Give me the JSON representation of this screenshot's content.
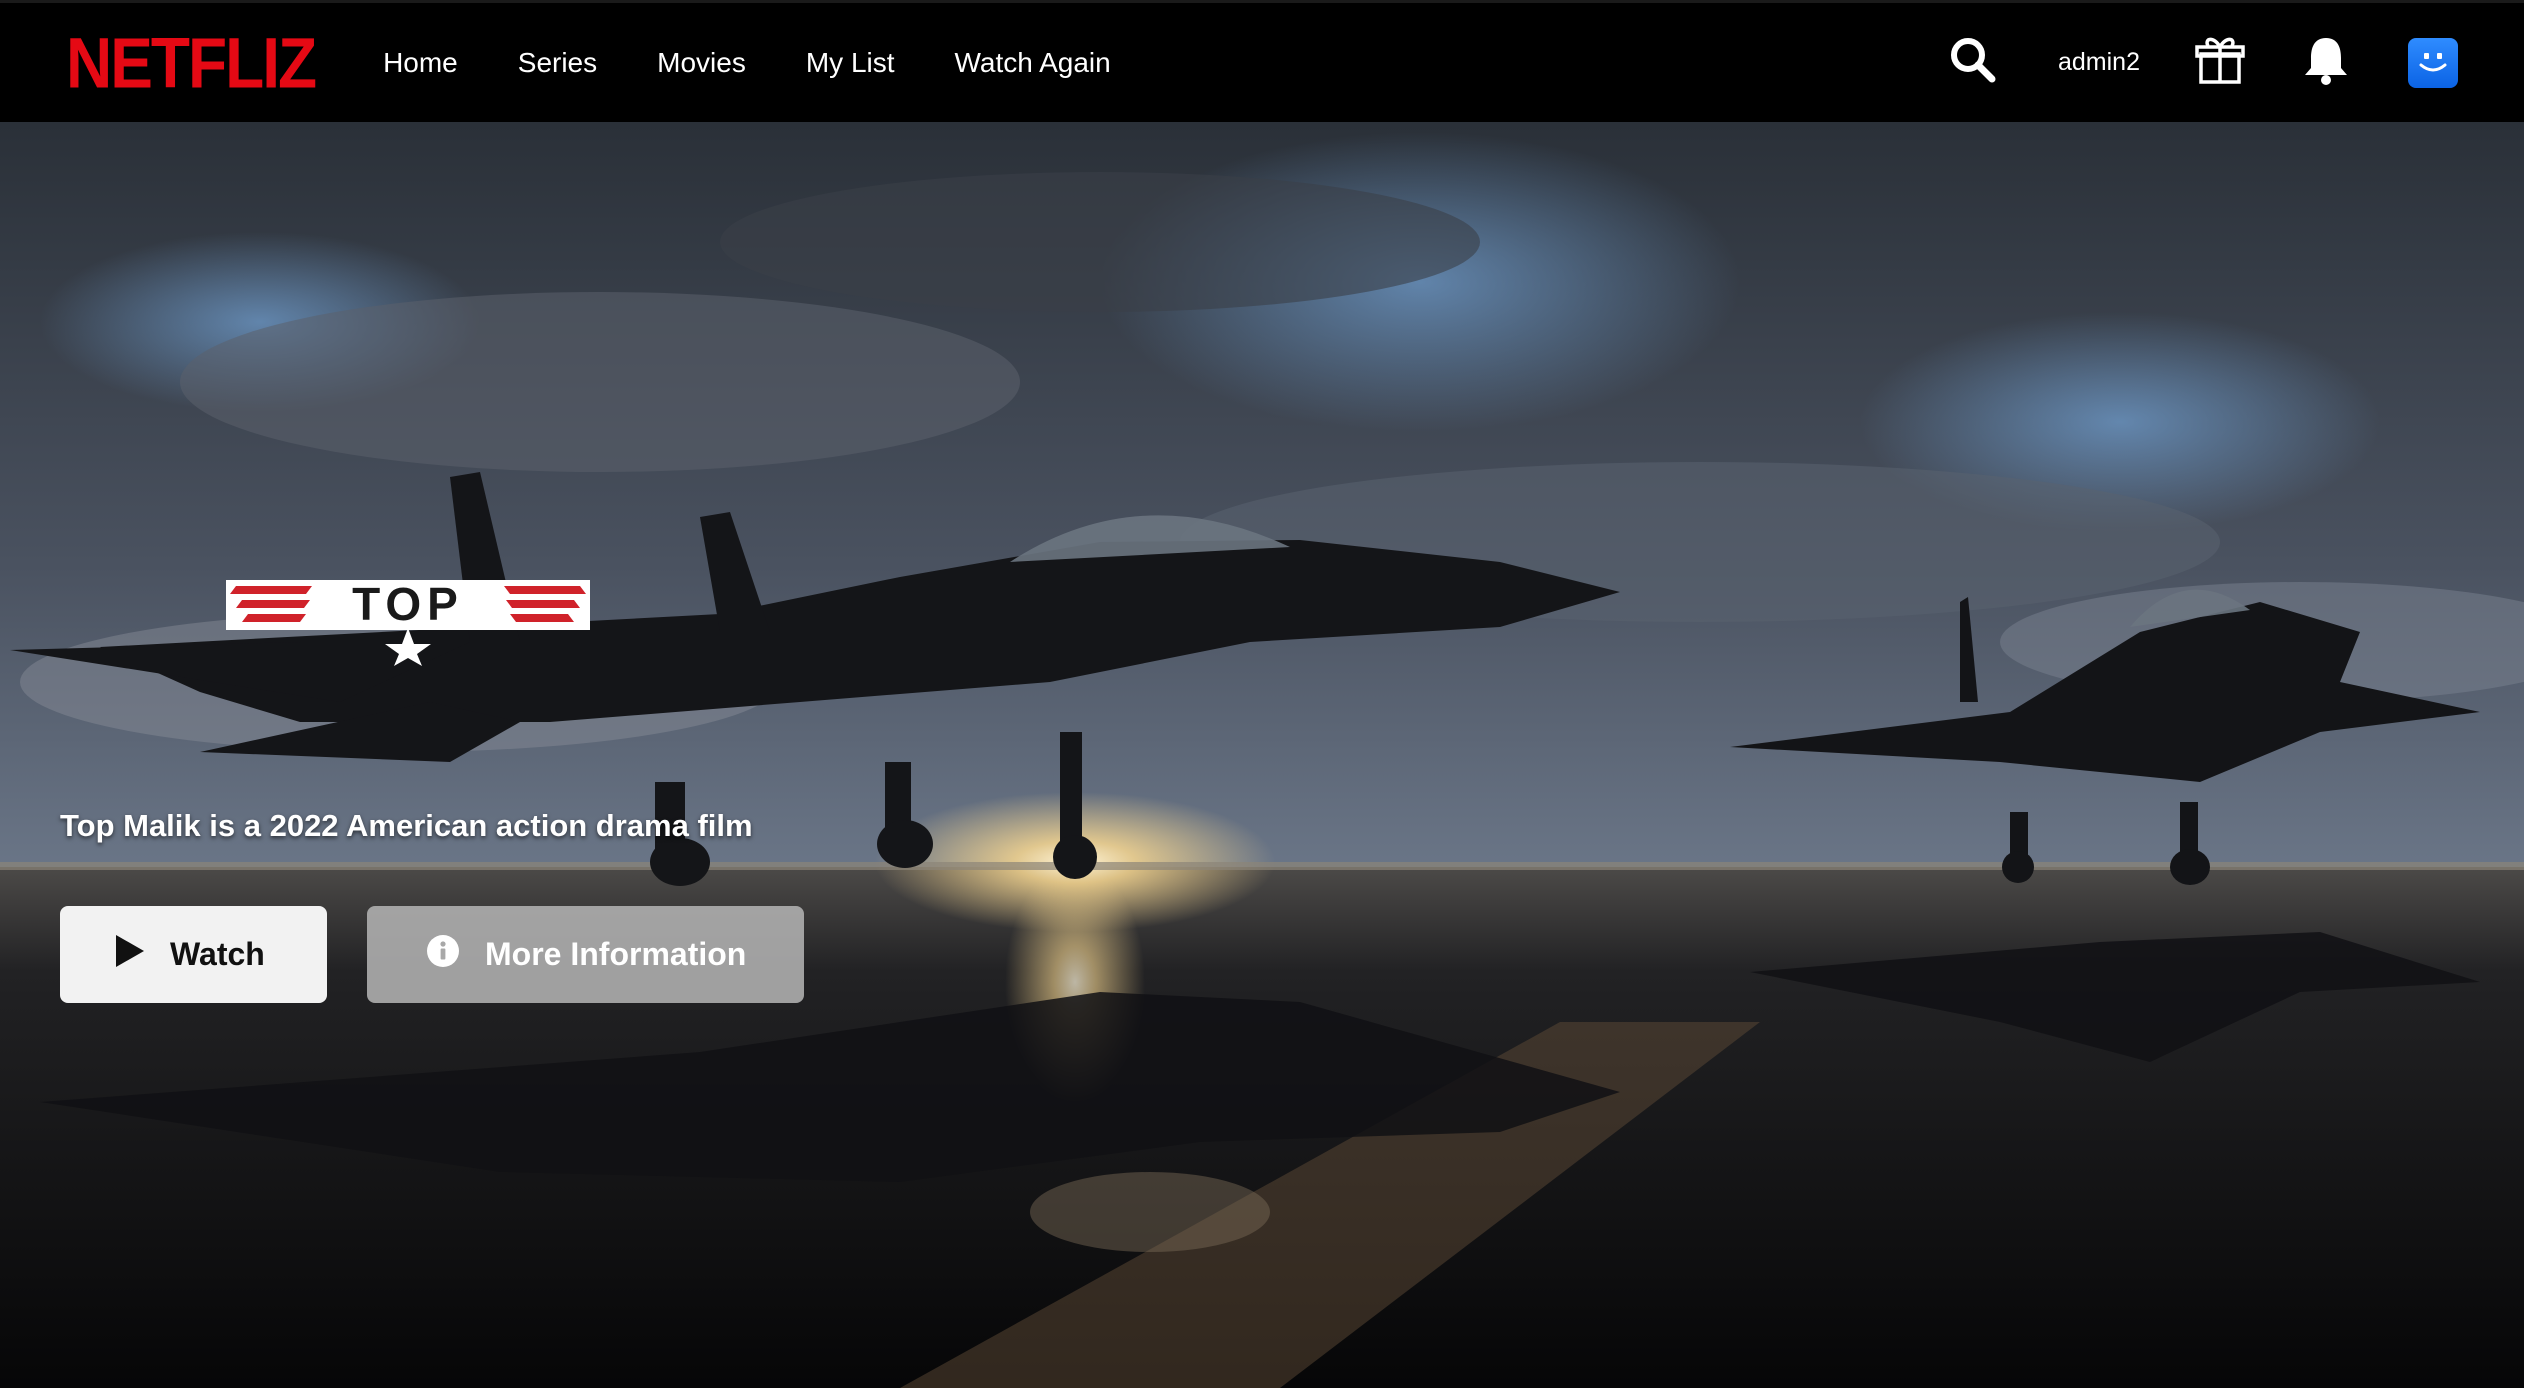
{
  "brand": {
    "logo_text": "NETFLIZ",
    "color": "#e50914"
  },
  "nav": {
    "links": [
      {
        "label": "Home"
      },
      {
        "label": "Series"
      },
      {
        "label": "Movies"
      },
      {
        "label": "My List"
      },
      {
        "label": "Watch Again"
      }
    ],
    "username": "admin2",
    "icons": [
      "search-icon",
      "gift-icon",
      "bell-icon",
      "avatar"
    ]
  },
  "hero": {
    "title_logo_text": "TOP",
    "description": "Top Malik is a 2022 American action drama film",
    "watch_label": "Watch",
    "more_info_label": "More Information"
  },
  "colors": {
    "nav_background": "#000000",
    "watch_button": "#f2f2f2",
    "info_button": "#b2b2b2",
    "avatar": "#1a7cf0"
  }
}
